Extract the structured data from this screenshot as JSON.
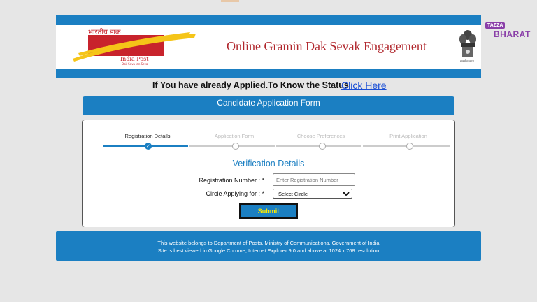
{
  "header": {
    "logo_hindi": "भारतीय डाक",
    "logo_english": "India Post",
    "logo_tagline": "Dak Seva Jan Seva",
    "title": "Online Gramin Dak Sevak Engagement",
    "emblem_caption": "सत्यमेव जयते",
    "colors": {
      "bar": "#1b7fc2",
      "title": "#b0262c",
      "logo_red": "#c8232c",
      "logo_yellow": "#f5c518"
    }
  },
  "watermark": {
    "top": "TAZZA",
    "bottom": "BHARAT"
  },
  "status": {
    "text": "If You have already Applied.To Know the Status",
    "link_label": "Click Here"
  },
  "form": {
    "banner_title": "Candidate Application Form",
    "steps": [
      {
        "label": "Registration Details",
        "state": "completed"
      },
      {
        "label": "Application Form",
        "state": "pending"
      },
      {
        "label": "Choose Preferences",
        "state": "pending"
      },
      {
        "label": "Print Application",
        "state": "pending"
      }
    ],
    "section_title": "Verification Details",
    "registration_label": "Registration Number : *",
    "registration_placeholder": "Enter Registration Number",
    "circle_label": "Circle Applying for : *",
    "circle_selected": "Select Circle",
    "submit_label": "Submit"
  },
  "footer": {
    "line1": "This website belongs to Department of Posts, Ministry of Communications, Government of India",
    "line2": "Site is best viewed in Google Chrome, Internet Explorer 9.0 and above at 1024 x 768 resolution"
  }
}
